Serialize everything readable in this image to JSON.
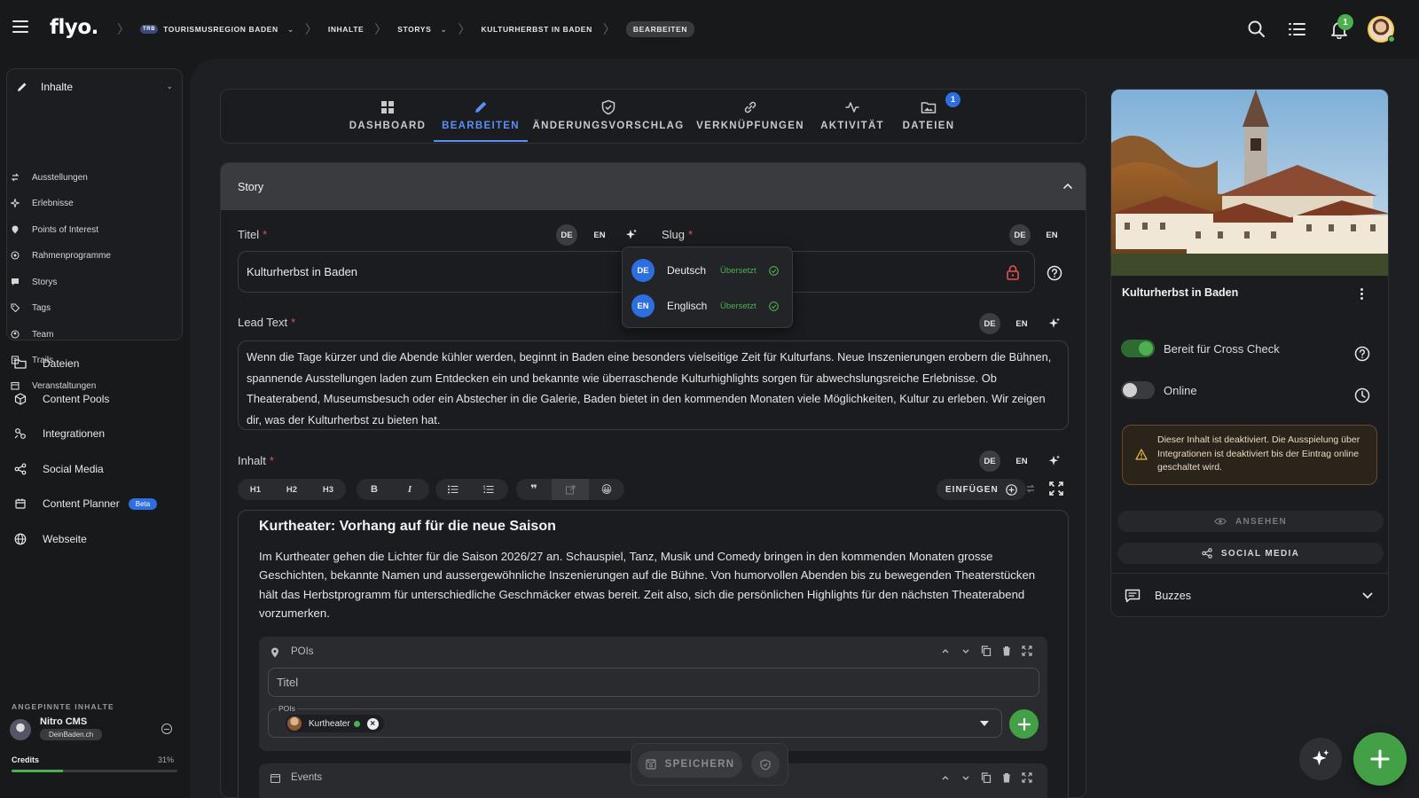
{
  "app": {
    "logo": "flyo."
  },
  "breadcrumb": [
    {
      "label": "TOURISMUSREGION BADEN",
      "badge": "TRB",
      "dropdown": true
    },
    {
      "label": "INHALTE"
    },
    {
      "label": "STORYS",
      "dropdown": true
    },
    {
      "label": "KULTURHERBST IN BADEN"
    },
    {
      "label": "BEARBEITEN",
      "active": true
    }
  ],
  "header": {
    "notification_count": "1"
  },
  "sidebar": {
    "group_label": "Inhalte",
    "sub_items": [
      {
        "label": "Ausstellungen",
        "icon": "arrows-icon"
      },
      {
        "label": "Erlebnisse",
        "icon": "sparkle-icon"
      },
      {
        "label": "Points of Interest",
        "icon": "pin-icon"
      },
      {
        "label": "Rahmenprogramme",
        "icon": "target-icon"
      },
      {
        "label": "Storys",
        "icon": "chat-icon"
      },
      {
        "label": "Tags",
        "icon": "tag-icon"
      },
      {
        "label": "Team",
        "icon": "team-icon"
      },
      {
        "label": "Trails",
        "icon": "book-icon"
      },
      {
        "label": "Veranstaltungen",
        "icon": "calendar-icon"
      }
    ],
    "main_items": [
      {
        "label": "Dateien",
        "icon": "folder-icon"
      },
      {
        "label": "Content Pools",
        "icon": "cube-icon"
      },
      {
        "label": "Integrationen",
        "icon": "integration-icon"
      },
      {
        "label": "Social Media",
        "icon": "share-icon"
      },
      {
        "label": "Content Planner",
        "icon": "planner-icon",
        "badge": "Beta"
      },
      {
        "label": "Webseite",
        "icon": "globe-icon"
      }
    ],
    "pinned_title": "ANGEPINNTE INHALTE",
    "pinned": {
      "name": "Nitro CMS",
      "tag": "DeinBaden.ch"
    },
    "credits_label": "Credits",
    "credits_value": "31%",
    "credits_fraction": 0.31
  },
  "tabs": [
    {
      "label": "DASHBOARD",
      "icon": "grid-icon"
    },
    {
      "label": "BEARBEITEN",
      "icon": "pencil-icon",
      "active": true
    },
    {
      "label": "ÄNDERUNGSVORSCHLAG",
      "icon": "shield-check-icon"
    },
    {
      "label": "VERKNÜPFUNGEN",
      "icon": "link-icon"
    },
    {
      "label": "AKTIVITÄT",
      "icon": "activity-icon"
    },
    {
      "label": "DATEIEN",
      "icon": "folder-image-icon",
      "badge": "1"
    }
  ],
  "section": {
    "title": "Story"
  },
  "fields": {
    "title": {
      "label": "Titel",
      "value": "Kulturherbst in Baden"
    },
    "slug": {
      "label": "Slug"
    },
    "lead": {
      "label": "Lead Text",
      "value": "Wenn die Tage kürzer und die Abende kühler werden, beginnt in Baden eine besonders vielseitige Zeit für Kulturfans. Neue Inszenierungen erobern die Bühnen, spannende Ausstellungen laden zum Entdecken ein und bekannte wie überraschende Kulturhighlights sorgen für abwechslungsreiche Erlebnisse. Ob Theaterabend, Museumsbesuch oder ein Abstecher in die Galerie, Baden bietet in den kommenden Monaten viele Möglichkeiten, Kultur zu erleben. Wir zeigen dir, was der Kulturherbst zu bieten hat."
    },
    "content": {
      "label": "Inhalt"
    },
    "lang_de": "DE",
    "lang_en": "EN"
  },
  "lang_dropdown": [
    {
      "code": "DE",
      "name": "Deutsch",
      "status": "Übersetzt"
    },
    {
      "code": "EN",
      "name": "Englisch",
      "status": "Übersetzt"
    }
  ],
  "toolbar": {
    "headings": [
      "H1",
      "H2",
      "H3"
    ],
    "insert_label": "EINFÜGEN"
  },
  "editor": {
    "heading": "Kurtheater: Vorhang auf für die neue Saison",
    "paragraph": "Im Kurtheater gehen die Lichter für die Saison 2026/27 an. Schauspiel, Tanz, Musik und Comedy bringen in den kommenden Monaten grosse Geschichten, bekannte Namen und aussergewöhnliche Inszenierungen auf die Bühne. Von humorvollen Abenden bis zu bewegenden Theaterstücken hält das Herbstprogramm für unterschiedliche Geschmäcker etwas bereit. Zeit also, sich die persönlichen Highlights für den nächsten Theaterabend vorzumerken."
  },
  "pois_block": {
    "title": "POIs",
    "title_placeholder": "Titel",
    "select_label": "POIs",
    "chip": "Kurtheater"
  },
  "events_block": {
    "title": "Events"
  },
  "save": {
    "label": "SPEICHERN"
  },
  "right_card": {
    "title": "Kulturherbst in Baden",
    "toggle_cross_check": {
      "label": "Bereit für Cross Check",
      "on": true
    },
    "toggle_online": {
      "label": "Online",
      "on": false
    },
    "warning": "Dieser Inhalt ist deaktiviert. Die Ausspielung über Integrationen ist deaktiviert bis der Eintrag online geschaltet wird.",
    "view_label": "ANSEHEN",
    "social_label": "SOCIAL MEDIA",
    "buzzes_label": "Buzzes"
  },
  "colors": {
    "accent_blue": "#5b8ef7",
    "green": "#43a047",
    "background": "#18191b"
  }
}
